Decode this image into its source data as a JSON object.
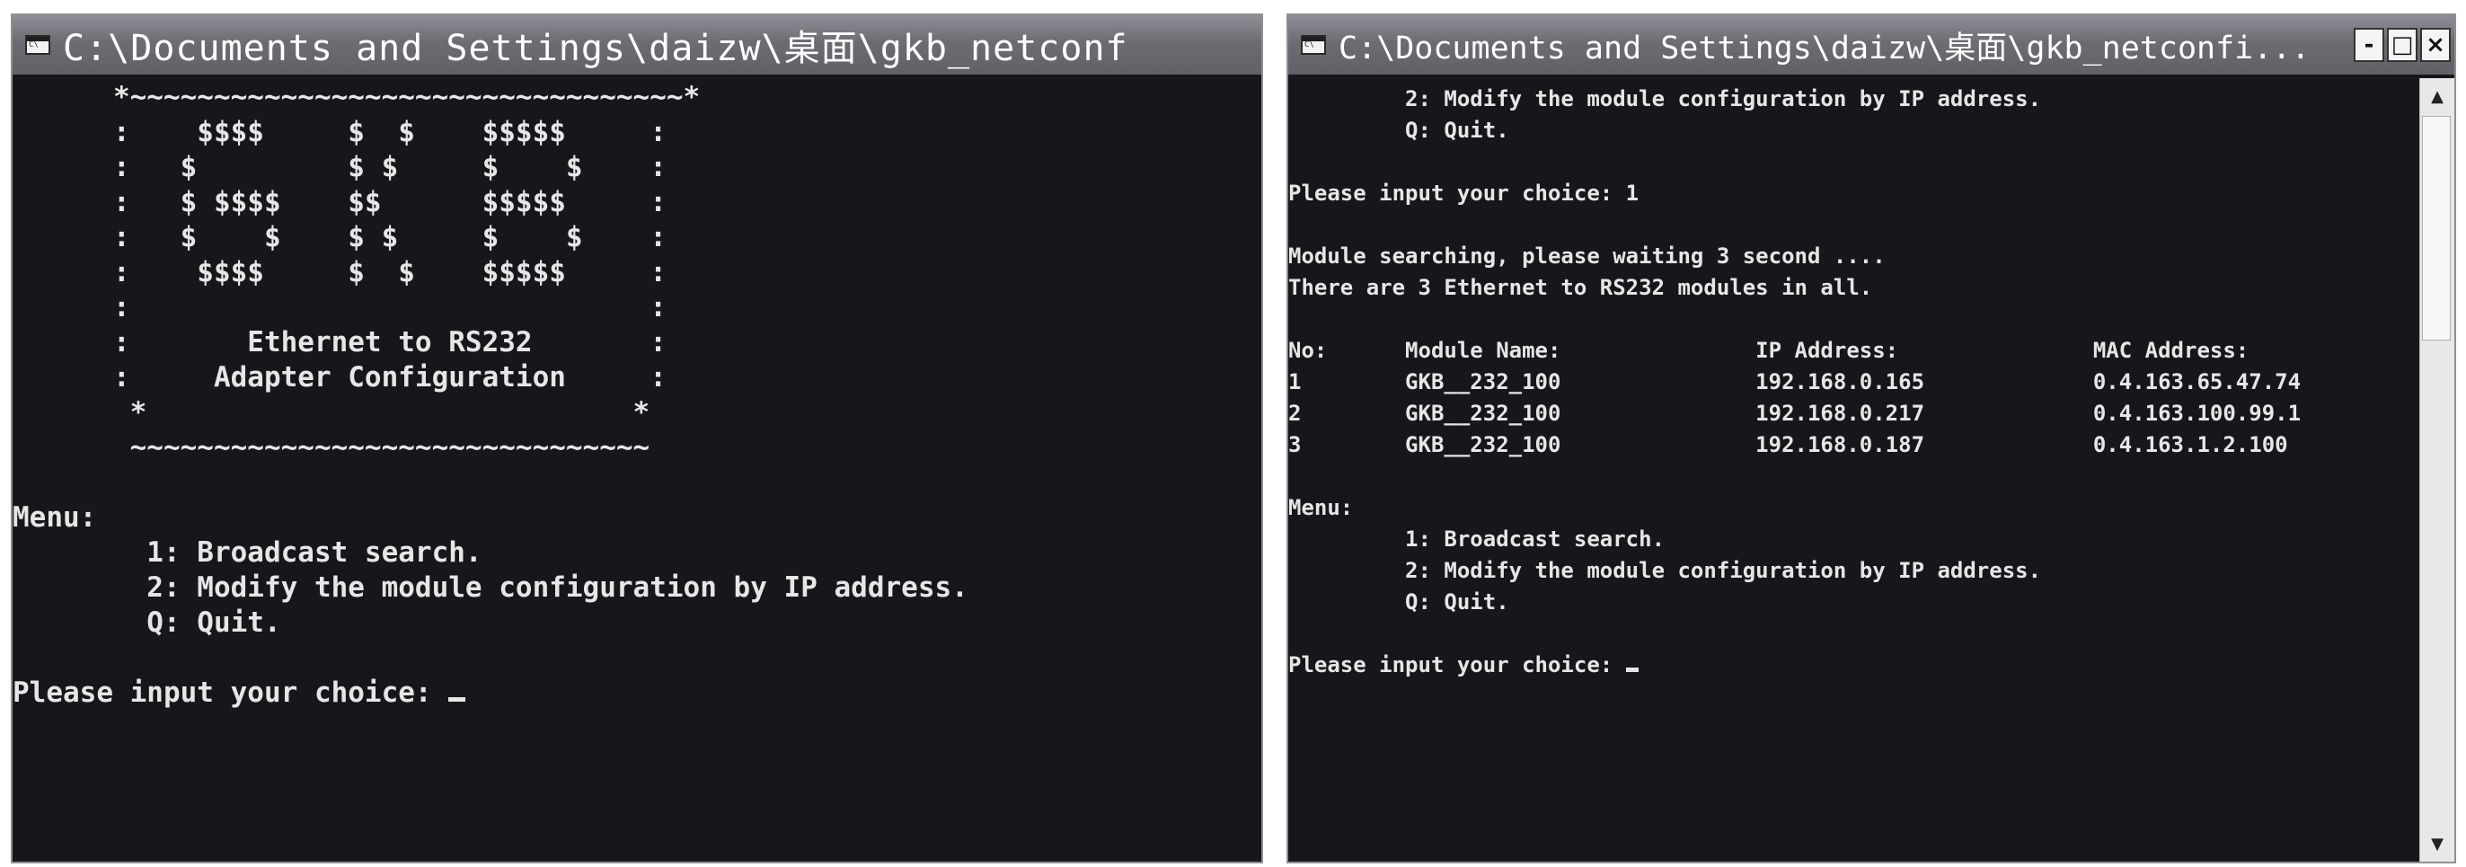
{
  "left_window": {
    "title": "C:\\Documents and Settings\\daizw\\桌面\\gkb_netconf",
    "lines": [
      "      *~~~~~~~~~~~~~~~~~~~~~~~~~~~~~~~~~*",
      "      :    $$$$     $  $    $$$$$     :",
      "      :   $         $ $     $    $    :",
      "      :   $ $$$$    $$      $$$$$     :",
      "      :   $    $    $ $     $    $    :",
      "      :    $$$$     $  $    $$$$$     :",
      "      :                               :",
      "      :       Ethernet to RS232       :",
      "      :     Adapter Configuration     :",
      "       *                             *",
      "       ~~~~~~~~~~~~~~~~~~~~~~~~~~~~~~~",
      "",
      "Menu:",
      "        1: Broadcast search.",
      "        2: Modify the module configuration by IP address.",
      "        Q: Quit.",
      "",
      "Please input your choice: "
    ]
  },
  "right_window": {
    "title": "C:\\Documents and Settings\\daizw\\桌面\\gkb_netconfi...",
    "controls": {
      "minimize": "-",
      "maximize": "□",
      "close": "×"
    },
    "lines": [
      "         2: Modify the module configuration by IP address.",
      "         Q: Quit.",
      "",
      "Please input your choice: 1",
      "",
      "Module searching, please waiting 3 second ....",
      "There are 3 Ethernet to RS232 modules in all.",
      "",
      "No:      Module Name:               IP Address:               MAC Address:",
      "1        GKB__232_100               192.168.0.165             0.4.163.65.47.74",
      "2        GKB__232_100               192.168.0.217             0.4.163.100.99.1",
      "3        GKB__232_100               192.168.0.187             0.4.163.1.2.100",
      "",
      "Menu:",
      "         1: Broadcast search.",
      "         2: Modify the module configuration by IP address.",
      "         Q: Quit.",
      "",
      "Please input your choice: "
    ],
    "scrollbar": {
      "up_arrow": "▲",
      "down_arrow": "▼"
    }
  }
}
